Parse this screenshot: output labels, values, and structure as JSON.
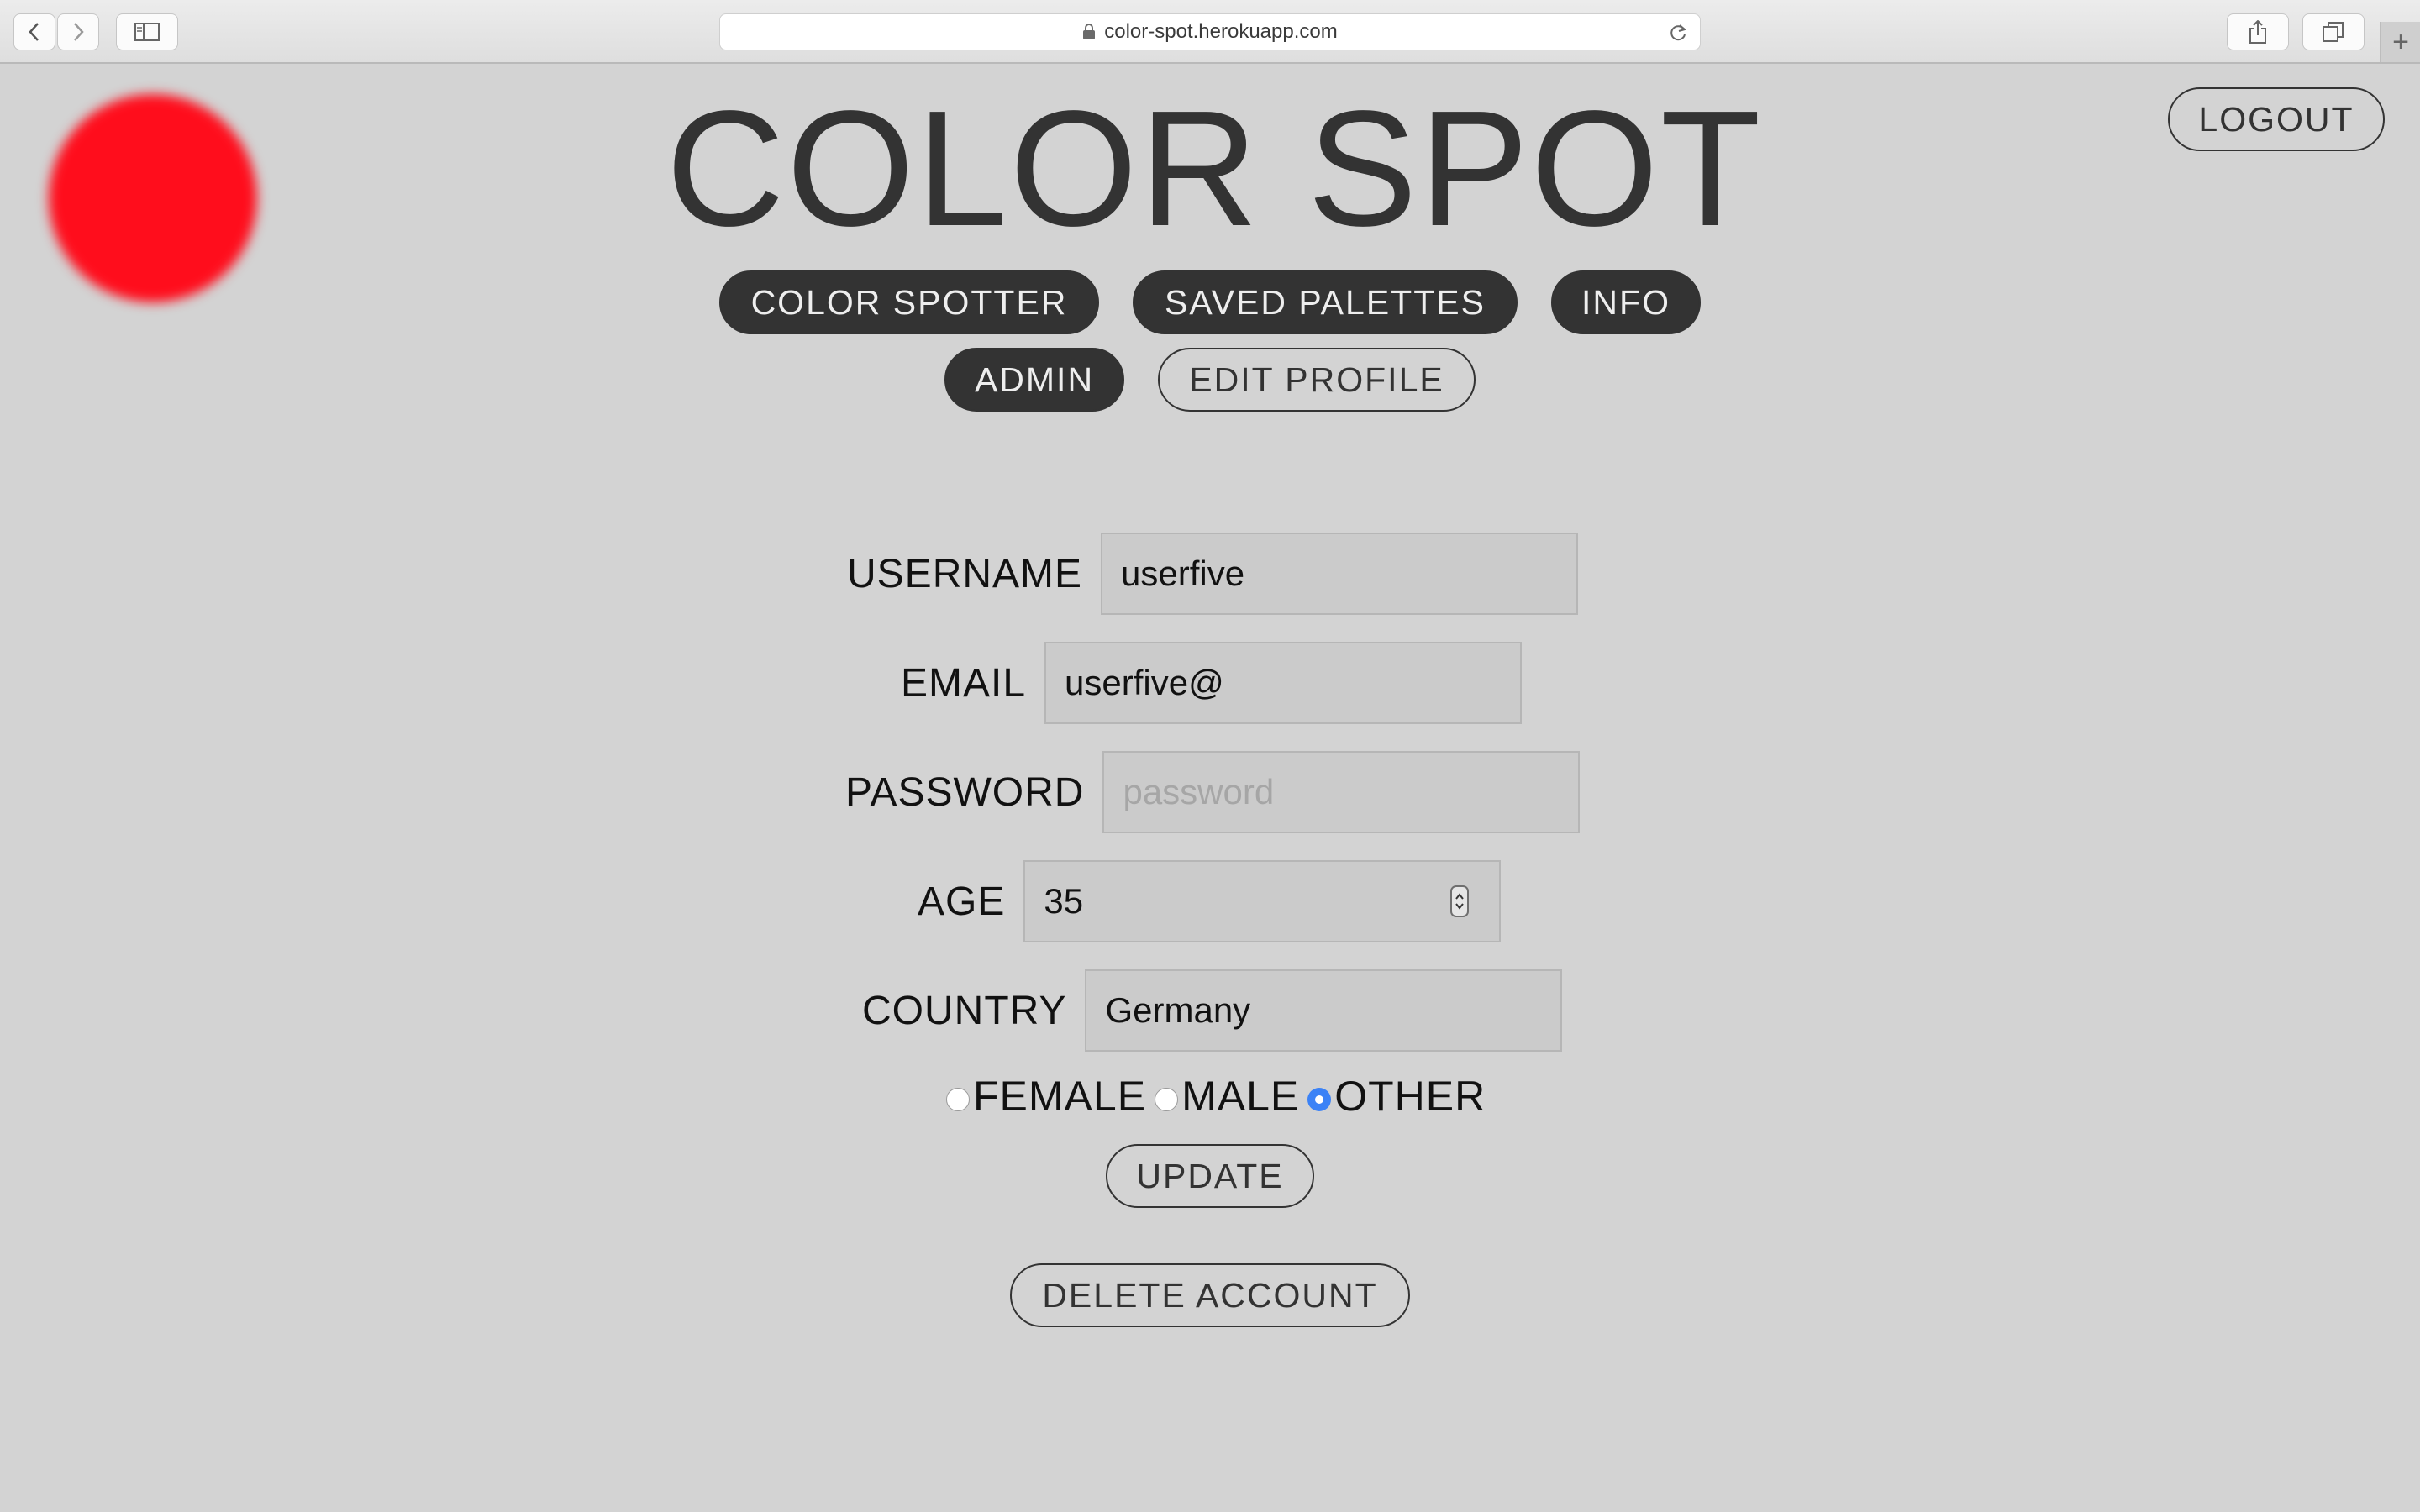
{
  "browser": {
    "url": "color-spot.herokuapp.com"
  },
  "header": {
    "title": "COLOR SPOT",
    "logout_label": "LOGOUT"
  },
  "nav": {
    "color_spotter": "COLOR SPOTTER",
    "saved_palettes": "SAVED PALETTES",
    "info": "INFO",
    "admin": "ADMIN",
    "edit_profile": "EDIT PROFILE"
  },
  "form": {
    "username": {
      "label": "USERNAME",
      "value": "userfive"
    },
    "email": {
      "label": "EMAIL",
      "value": "userfive@"
    },
    "password": {
      "label": "PASSWORD",
      "value": "",
      "placeholder": "password"
    },
    "age": {
      "label": "AGE",
      "value": "35"
    },
    "country": {
      "label": "COUNTRY",
      "value": "Germany"
    },
    "gender": {
      "options": [
        "FEMALE",
        "MALE",
        "OTHER"
      ],
      "selected": "OTHER"
    },
    "update_label": "UPDATE",
    "delete_label": "DELETE ACCOUNT"
  },
  "colors": {
    "spot": "#ff0d1c",
    "background": "#d3d3d3",
    "dark": "#333333",
    "radio_selected": "#3b82f6"
  },
  "icons": {
    "back": "chevron-left-icon",
    "forward": "chevron-right-icon",
    "sidebar": "sidebar-icon",
    "lock": "lock-icon",
    "reload": "reload-icon",
    "share": "share-icon",
    "tabs": "tabs-icon",
    "new_tab": "plus-icon"
  }
}
